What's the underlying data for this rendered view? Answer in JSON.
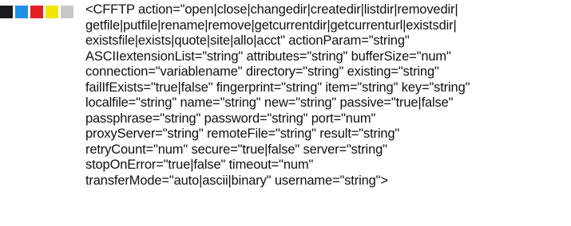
{
  "color_bar": {
    "colors": [
      "#1a1a1a",
      "#1e90e6",
      "#e41e26",
      "#f2e600",
      "#c7c7c7"
    ]
  },
  "syntax": {
    "lines": [
      "<CFFTP action=\"open|close|changedir|createdir|listdir|removedir|",
      "getfile|putfile|rename|remove|getcurrentdir|getcurrenturl|existsdir|",
      "existsfile|exists|quote|site|allo|acct\" actionParam=\"string\"",
      "ASCIIextensionList=\"string\" attributes=\"string\" bufferSize=\"num\"",
      "connection=\"variablename\" directory=\"string\" existing=\"string\"",
      "failIfExists=\"true|false\" fingerprint=\"string\" item=\"string\" key=\"string\"",
      "localfile=\"string\" name=\"string\" new=\"string\" passive=\"true|false\"",
      "passphrase=\"string\" password=\"string\" port=\"num\"",
      "proxyServer=\"string\" remoteFile=\"string\" result=\"string\"",
      "retryCount=\"num\" secure=\"true|false\" server=\"string\"",
      "stopOnError=\"true|false\" timeout=\"num\"",
      "transferMode=\"auto|ascii|binary\" username=\"string\">"
    ]
  }
}
